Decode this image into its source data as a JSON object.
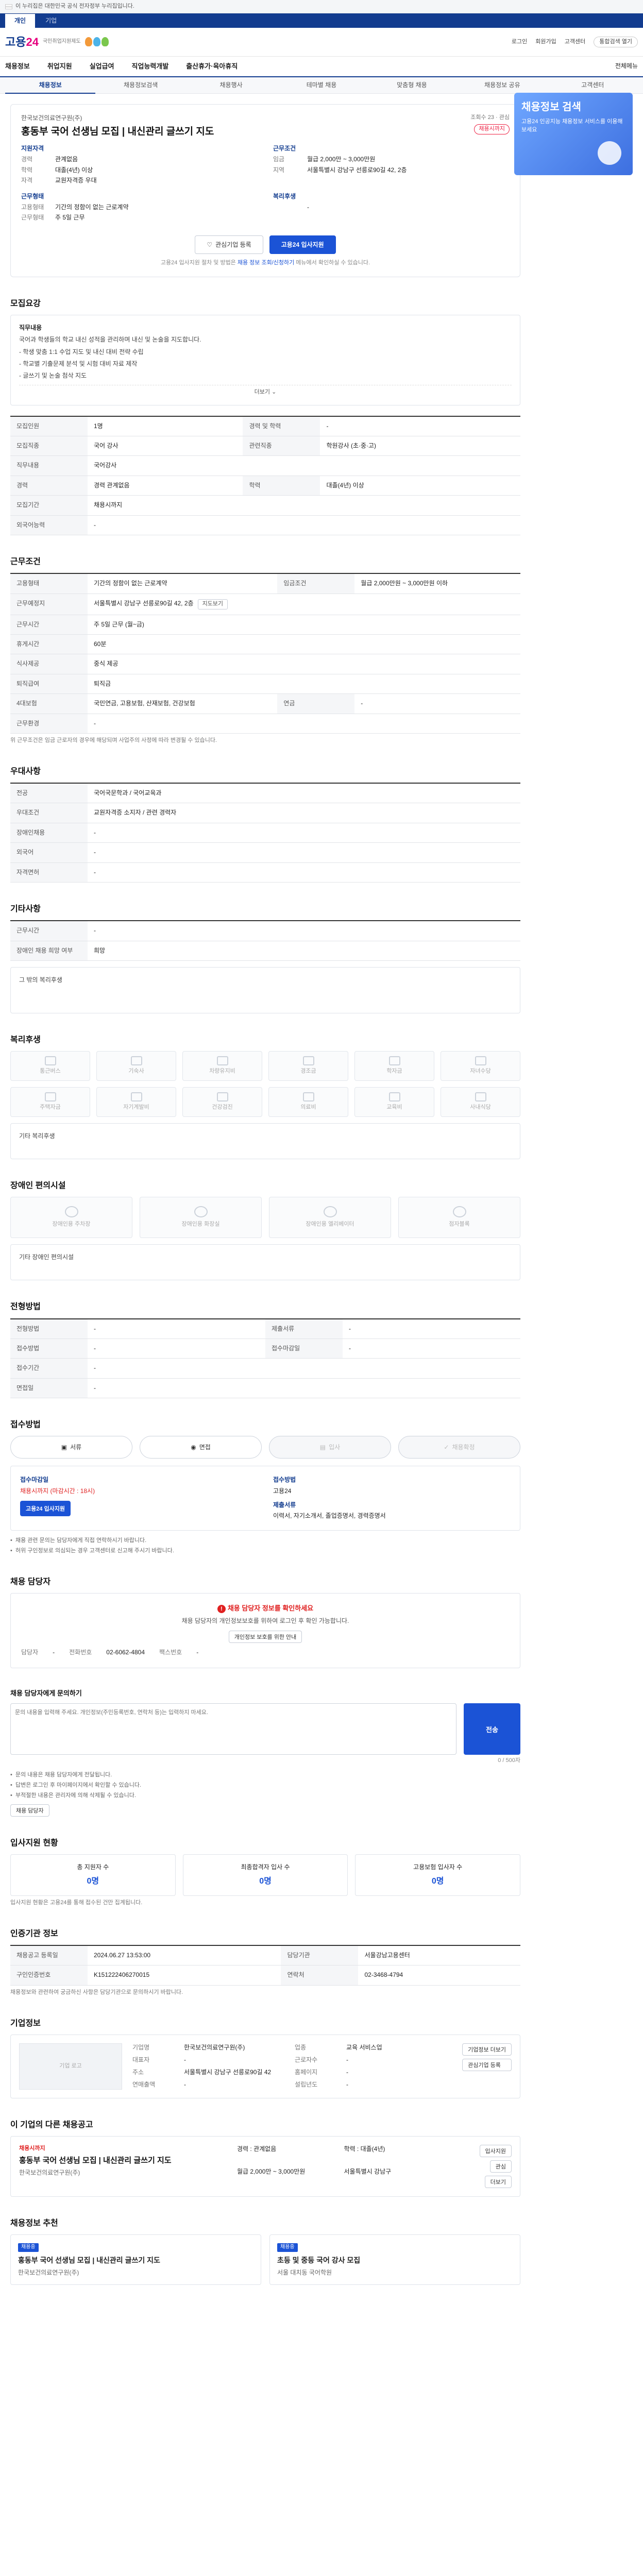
{
  "gov_bar": "이 누리집은 대한민국 공식 전자정부 누리집입니다.",
  "top_tabs": [
    "개인",
    "기업"
  ],
  "logo": {
    "name": "고용24",
    "sub": "국민취업지원제도"
  },
  "util": [
    "로그인",
    "회원가입",
    "고객센터",
    "통합검색 열기"
  ],
  "gnb": [
    "채용정보",
    "취업지원",
    "실업급여",
    "직업능력개발",
    "출산휴가·육아휴직",
    "전체메뉴"
  ],
  "subnav": [
    "채용정보",
    "채용정보검색",
    "채용행사",
    "테마별 채용",
    "맞춤형 채용",
    "채용정보 공유",
    "고객센터"
  ],
  "side_banner": {
    "title": "채용정보 검색",
    "text": "고용24 인공지능 채용정보 서비스를 이용해 보세요"
  },
  "summary": {
    "company": "한국보건의료연구원(주)",
    "title": "홍동부 국어 선생님 모집 | 내신관리 글쓰기 지도",
    "views": "조회수",
    "views_count": "23",
    "scrap": "관심",
    "deadline_badge": "채용시까지",
    "left_head": "지원자격",
    "right_head": "근무조건",
    "left_kv": [
      {
        "k": "경력",
        "v": "관계없음"
      },
      {
        "k": "학력",
        "v": "대졸(4년) 이상"
      },
      {
        "k": "자격",
        "v": "교원자격증 우대"
      }
    ],
    "right_kv": [
      {
        "k": "임금",
        "v": "월급 2,000만 ~ 3,000만원"
      },
      {
        "k": "지역",
        "v": "서울특별시 강남구 선릉로90길 42, 2층"
      }
    ],
    "bottom_left_head": "근무형태",
    "bottom_left_kv": [
      {
        "k": "고용형태",
        "v": "기간의 정함이 없는 근로계약"
      },
      {
        "k": "근무형태",
        "v": "주 5일 근무"
      }
    ],
    "bottom_right_head": "복리후생",
    "bottom_right_kv": [
      {
        "k": "",
        "v": "-"
      }
    ],
    "interest_btn": "관심기업 등록",
    "apply_btn": "고용24 입사지원",
    "note_pre": "고용24 입사지원 절차 및 방법은 ",
    "note_link": "채용 정보 조회/신청하기",
    "note_post": " 메뉴에서 확인하실 수 있습니다."
  },
  "sections": {
    "job_desc": "모집요강",
    "job_desc_lines": [
      "직무내용",
      "국어과 학생들의 학교 내신 성적을 관리하며 내신 및 논술을 지도합니다.",
      "",
      "- 학생 맞춤 1:1 수업 지도 및 내신 대비 전략 수립",
      "- 학교별 기출문제 분석 및 시험 대비 자료 제작",
      "- 글쓰기 및 논술 첨삭 지도"
    ],
    "more": "더보기"
  },
  "job_table": [
    {
      "k": "모집인원",
      "v": "1명",
      "k2": "경력 및 학력",
      "v2": "-"
    },
    {
      "k": "모집직종",
      "v": "국어 강사",
      "k2": "관련직종",
      "v2": "학원강사 (초·중·고)"
    },
    {
      "k": "직무내용",
      "v": "국어강사",
      "k2": "",
      "v2": ""
    },
    {
      "k": "경력",
      "v": "경력 관계없음",
      "k2": "학력",
      "v2": "대졸(4년) 이상"
    },
    {
      "k": "모집기간",
      "v": "채용시까지",
      "k2": "",
      "v2": ""
    },
    {
      "k": "외국어능력",
      "v": "-",
      "k2": "",
      "v2": ""
    }
  ],
  "work_title": "근무조건",
  "work_table": [
    {
      "k": "고용형태",
      "v": "기간의 정함이 없는 근로계약",
      "k2": "임금조건",
      "v2": "월급 2,000만원 ~ 3,000만원 이하"
    },
    {
      "k": "근무예정지",
      "v": "서울특별시 강남구 선릉로90길 42, 2층",
      "k2": "",
      "v2": ""
    },
    {
      "k": "근무시간",
      "v": "주 5일 근무 (월~금)",
      "k2": "",
      "v2": ""
    },
    {
      "k": "휴게시간",
      "v": "60분",
      "k2": "",
      "v2": ""
    },
    {
      "k": "식사제공",
      "v": "중식 제공",
      "k2": "",
      "v2": ""
    },
    {
      "k": "퇴직급여",
      "v": "퇴직금",
      "k2": "",
      "v2": ""
    },
    {
      "k": "4대보험",
      "v": "국민연금, 고용보험, 산재보험, 건강보험",
      "k2": "연금",
      "v2": "-"
    },
    {
      "k": "근무환경",
      "v": "-",
      "k2": "",
      "v2": ""
    }
  ],
  "work_note": "위 근무조건은 임금 근로자의 경우에 해당되며 사업주의 사정에 따라 변경될 수 있습니다.",
  "prefer_title": "우대사항",
  "prefer_table": [
    {
      "k": "전공",
      "v": "국어국문학과 / 국어교육과"
    },
    {
      "k": "우대조건",
      "v": "교원자격증 소지자 / 관련 경력자"
    },
    {
      "k": "장애인채용",
      "v": "-"
    },
    {
      "k": "외국어",
      "v": "-"
    },
    {
      "k": "자격면허",
      "v": "-"
    }
  ],
  "other_title": "기타사항",
  "other_table": [
    {
      "k": "근무시간",
      "v": "-"
    },
    {
      "k": "장애인 채용 희망 여부",
      "v": "희망"
    }
  ],
  "other_box": "그 밖의 복리후생",
  "welfare_title": "복리후생",
  "welfare_items": [
    "통근버스",
    "기숙사",
    "차량유지비",
    "경조금",
    "학자금",
    "자녀수당",
    "주택자금",
    "자기계발비",
    "건강검진",
    "의료비",
    "교육비",
    "사내식당"
  ],
  "welfare_box": "기타 복리후생",
  "facility_title": "장애인 편의시설",
  "facility_items": [
    "장애인용 주차장",
    "장애인용 화장실",
    "장애인용 엘리베이터",
    "점자블록"
  ],
  "facility_box": "기타 장애인 편의시설",
  "process_title": "전형방법",
  "process_table": [
    {
      "k": "전형방법",
      "v": "-",
      "k2": "제출서류",
      "v2": "-"
    },
    {
      "k": "접수방법",
      "v": "-",
      "k2": "접수마감일",
      "v2": "-"
    },
    {
      "k": "접수기간",
      "v": "-",
      "k2": "",
      "v2": ""
    },
    {
      "k": "면접일",
      "v": "-",
      "k2": "",
      "v2": ""
    }
  ],
  "steps_title": "접수방법",
  "steps": [
    "서류",
    "면접",
    "입사",
    "채용확정"
  ],
  "apply_col1_h": "접수마감일",
  "apply_col1_v": "채용시까지 (마감시간 : 18시)",
  "apply_col1_btn": "고용24 입사지원",
  "apply_col2_h": "접수방법",
  "apply_col2_v": "고용24",
  "apply_col3_h": "제출서류",
  "apply_col3_v": "이력서, 자기소개서, 졸업증명서, 경력증명서",
  "bullets": [
    "채용 관련 문의는 담당자에게 직접 연락하시기 바랍니다.",
    "허위 구인정보로 의심되는 경우 고객센터로 신고해 주시기 바랍니다."
  ],
  "manager_title": "채용 담당자",
  "manager_warn": "채용 담당자 정보를 확인하세요",
  "manager_text": "채용 담당자의 개인정보보호를 위하여 로그인 후 확인 가능합니다.",
  "manager_btn": "개인정보 보호를 위한 안내",
  "manager_name_k": "담당자",
  "manager_name_v": "-",
  "manager_tel_k": "전화번호",
  "manager_tel_v": "02-6062-4804",
  "manager_fax_k": "팩스번호",
  "manager_fax_v": "-",
  "inquiry_title": "채용 담당자에게 문의하기",
  "inquiry_placeholder": "문의 내용을 입력해 주세요. 개인정보(주민등록번호, 연락처 등)는 입력하지 마세요.",
  "inquiry_send": "전송",
  "inquiry_count": "0 / 500자",
  "inquiry_bullets": [
    "문의 내용은 채용 담당자에게 전달됩니다.",
    "답변은 로그인 후 마이페이지에서 확인할 수 있습니다.",
    "부적절한 내용은 관리자에 의해 삭제될 수 있습니다."
  ],
  "inquiry_btn": "채용 담당자",
  "stats_title": "입사지원 현황",
  "stats": [
    {
      "label": "총 지원자 수",
      "value": "0명"
    },
    {
      "label": "최종합격자 입사 수",
      "value": "0명"
    },
    {
      "label": "고용보험 입사자 수",
      "value": "0명"
    }
  ],
  "stats_note": "입사지원 현황은 고용24를 통해 접수된 건만 집계됩니다.",
  "agency_title": "인증기관 정보",
  "agency_table": [
    {
      "k": "채용공고 등록일",
      "v": "2024.06.27 13:53:00",
      "k2": "담당기관",
      "v2": "서울강남고용센터"
    },
    {
      "k": "구인인증번호",
      "v": "K151222406270015",
      "k2": "연락처",
      "v2": "02-3468-4794"
    }
  ],
  "agency_note": "채용정보와 관련하여 궁금하신 사항은 담당기관으로 문의하시기 바랍니다.",
  "company_title": "기업정보",
  "company_logo": "기업 로고",
  "company_kv": [
    {
      "k": "기업명",
      "v": "한국보건의료연구원(주)",
      "k2": "업종",
      "v2": "교육 서비스업"
    },
    {
      "k": "대표자",
      "v": "-",
      "k2": "근로자수",
      "v2": "-"
    },
    {
      "k": "주소",
      "v": "서울특별시 강남구 선릉로90길 42",
      "k2": "홈페이지",
      "v2": "-"
    },
    {
      "k": "연매출액",
      "v": "-",
      "k2": "설립년도",
      "v2": "-"
    }
  ],
  "company_btns": [
    "기업정보 더보기",
    "관심기업 등록"
  ],
  "same_title": "이 기업의 다른 채용공고",
  "same": {
    "label": "채용시까지",
    "job": "홍동부 국어 선생님 모집 | 내신관리 글쓰기 지도",
    "company": "한국보건의료연구원(주)",
    "meta": [
      "경력 : 관계없음",
      "학력 : 대졸(4년)",
      "월급 2,000만 ~ 3,000만원",
      "서울특별시 강남구"
    ],
    "btns": [
      "입사지원",
      "관심",
      "더보기"
    ]
  },
  "recommend_title": "채용정보 추천",
  "recommend": [
    {
      "badge": "채용중",
      "title": "홍동부 국어 선생님 모집 | 내신관리 글쓰기 지도",
      "company": "한국보건의료연구원(주)"
    },
    {
      "badge": "채용중",
      "title": "초등 및 중등 국어 강사 모집",
      "company": "서울 대치동 국어학원"
    }
  ]
}
